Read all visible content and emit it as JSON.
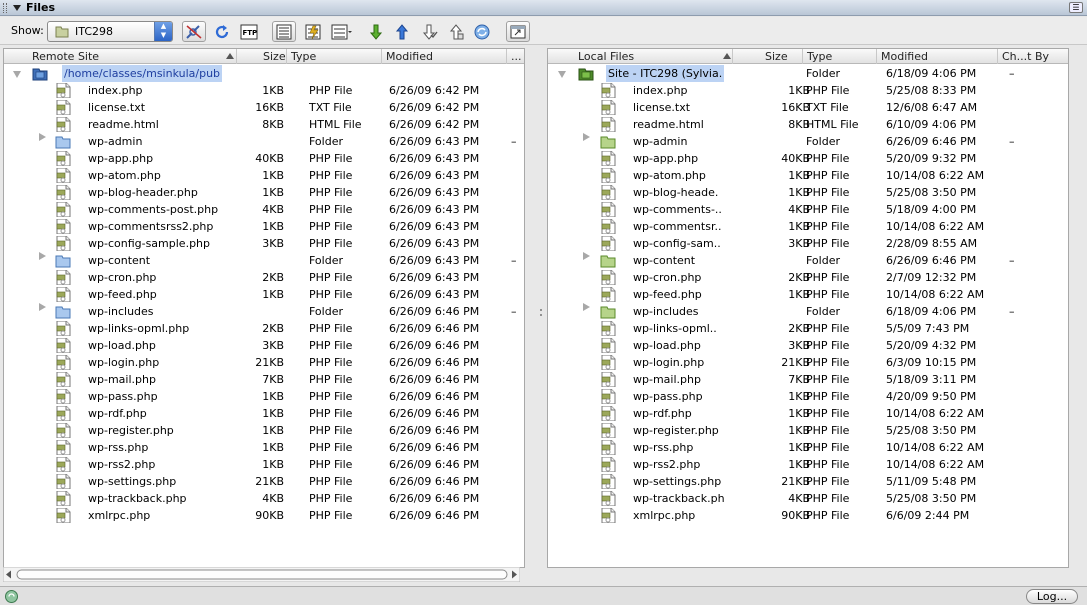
{
  "panel": {
    "title": "Files"
  },
  "toolbar": {
    "show_label": "Show:",
    "site_value": "ITC298"
  },
  "remote": {
    "headers": {
      "name": "Remote Site",
      "size": "Size",
      "type": "Type",
      "modified": "Modified",
      "more": "..."
    },
    "root": "/home/classes/msinkula/pub",
    "rows": [
      {
        "name": "index.php",
        "size": "1KB",
        "type": "PHP File",
        "modified": "6/26/09 6:42 PM",
        "folder": false
      },
      {
        "name": "license.txt",
        "size": "16KB",
        "type": "TXT File",
        "modified": "6/26/09 6:42 PM",
        "folder": false
      },
      {
        "name": "readme.html",
        "size": "8KB",
        "type": "HTML File",
        "modified": "6/26/09 6:42 PM",
        "folder": false
      },
      {
        "name": "wp-admin",
        "size": "",
        "type": "Folder",
        "modified": "6/26/09 6:43 PM",
        "folder": true,
        "extra": "–"
      },
      {
        "name": "wp-app.php",
        "size": "40KB",
        "type": "PHP File",
        "modified": "6/26/09 6:43 PM",
        "folder": false
      },
      {
        "name": "wp-atom.php",
        "size": "1KB",
        "type": "PHP File",
        "modified": "6/26/09 6:43 PM",
        "folder": false
      },
      {
        "name": "wp-blog-header.php",
        "size": "1KB",
        "type": "PHP File",
        "modified": "6/26/09 6:43 PM",
        "folder": false
      },
      {
        "name": "wp-comments-post.php",
        "size": "4KB",
        "type": "PHP File",
        "modified": "6/26/09 6:43 PM",
        "folder": false
      },
      {
        "name": "wp-commentsrss2.php",
        "size": "1KB",
        "type": "PHP File",
        "modified": "6/26/09 6:43 PM",
        "folder": false
      },
      {
        "name": "wp-config-sample.php",
        "size": "3KB",
        "type": "PHP File",
        "modified": "6/26/09 6:43 PM",
        "folder": false
      },
      {
        "name": "wp-content",
        "size": "",
        "type": "Folder",
        "modified": "6/26/09 6:43 PM",
        "folder": true,
        "extra": "–"
      },
      {
        "name": "wp-cron.php",
        "size": "2KB",
        "type": "PHP File",
        "modified": "6/26/09 6:43 PM",
        "folder": false
      },
      {
        "name": "wp-feed.php",
        "size": "1KB",
        "type": "PHP File",
        "modified": "6/26/09 6:43 PM",
        "folder": false
      },
      {
        "name": "wp-includes",
        "size": "",
        "type": "Folder",
        "modified": "6/26/09 6:46 PM",
        "folder": true,
        "extra": "–"
      },
      {
        "name": "wp-links-opml.php",
        "size": "2KB",
        "type": "PHP File",
        "modified": "6/26/09 6:46 PM",
        "folder": false
      },
      {
        "name": "wp-load.php",
        "size": "3KB",
        "type": "PHP File",
        "modified": "6/26/09 6:46 PM",
        "folder": false
      },
      {
        "name": "wp-login.php",
        "size": "21KB",
        "type": "PHP File",
        "modified": "6/26/09 6:46 PM",
        "folder": false
      },
      {
        "name": "wp-mail.php",
        "size": "7KB",
        "type": "PHP File",
        "modified": "6/26/09 6:46 PM",
        "folder": false
      },
      {
        "name": "wp-pass.php",
        "size": "1KB",
        "type": "PHP File",
        "modified": "6/26/09 6:46 PM",
        "folder": false
      },
      {
        "name": "wp-rdf.php",
        "size": "1KB",
        "type": "PHP File",
        "modified": "6/26/09 6:46 PM",
        "folder": false
      },
      {
        "name": "wp-register.php",
        "size": "1KB",
        "type": "PHP File",
        "modified": "6/26/09 6:46 PM",
        "folder": false
      },
      {
        "name": "wp-rss.php",
        "size": "1KB",
        "type": "PHP File",
        "modified": "6/26/09 6:46 PM",
        "folder": false
      },
      {
        "name": "wp-rss2.php",
        "size": "1KB",
        "type": "PHP File",
        "modified": "6/26/09 6:46 PM",
        "folder": false
      },
      {
        "name": "wp-settings.php",
        "size": "21KB",
        "type": "PHP File",
        "modified": "6/26/09 6:46 PM",
        "folder": false
      },
      {
        "name": "wp-trackback.php",
        "size": "4KB",
        "type": "PHP File",
        "modified": "6/26/09 6:46 PM",
        "folder": false
      },
      {
        "name": "xmlrpc.php",
        "size": "90KB",
        "type": "PHP File",
        "modified": "6/26/09 6:46 PM",
        "folder": false
      }
    ]
  },
  "local": {
    "headers": {
      "name": "Local Files",
      "size": "Size",
      "type": "Type",
      "modified": "Modified",
      "checked": "Ch...t By"
    },
    "root": {
      "name": "Site - ITC298 (Sylvia.",
      "type": "Folder",
      "modified": "6/18/09 4:06 PM",
      "extra": "–"
    },
    "rows": [
      {
        "name": "index.php",
        "size": "1KB",
        "type": "PHP File",
        "modified": "5/25/08 8:33 PM",
        "folder": false
      },
      {
        "name": "license.txt",
        "size": "16KB",
        "type": "TXT File",
        "modified": "12/6/08 6:47 AM",
        "folder": false
      },
      {
        "name": "readme.html",
        "size": "8KB",
        "type": "HTML File",
        "modified": "6/10/09 4:06 PM",
        "folder": false
      },
      {
        "name": "wp-admin",
        "size": "",
        "type": "Folder",
        "modified": "6/26/09 6:46 PM",
        "folder": true,
        "extra": "–"
      },
      {
        "name": "wp-app.php",
        "size": "40KB",
        "type": "PHP File",
        "modified": "5/20/09 9:32 PM",
        "folder": false
      },
      {
        "name": "wp-atom.php",
        "size": "1KB",
        "type": "PHP File",
        "modified": "10/14/08 6:22 AM",
        "folder": false
      },
      {
        "name": "wp-blog-heade.",
        "size": "1KB",
        "type": "PHP File",
        "modified": "5/25/08 3:50 PM",
        "folder": false
      },
      {
        "name": "wp-comments-..",
        "size": "4KB",
        "type": "PHP File",
        "modified": "5/18/09 4:00 PM",
        "folder": false
      },
      {
        "name": "wp-commentsr..",
        "size": "1KB",
        "type": "PHP File",
        "modified": "10/14/08 6:22 AM",
        "folder": false
      },
      {
        "name": "wp-config-sam..",
        "size": "3KB",
        "type": "PHP File",
        "modified": "2/28/09 8:55 AM",
        "folder": false
      },
      {
        "name": "wp-content",
        "size": "",
        "type": "Folder",
        "modified": "6/26/09 6:46 PM",
        "folder": true,
        "extra": "–"
      },
      {
        "name": "wp-cron.php",
        "size": "2KB",
        "type": "PHP File",
        "modified": "2/7/09 12:32 PM",
        "folder": false
      },
      {
        "name": "wp-feed.php",
        "size": "1KB",
        "type": "PHP File",
        "modified": "10/14/08 6:22 AM",
        "folder": false
      },
      {
        "name": "wp-includes",
        "size": "",
        "type": "Folder",
        "modified": "6/18/09 4:06 PM",
        "folder": true,
        "extra": "–"
      },
      {
        "name": "wp-links-opml..",
        "size": "2KB",
        "type": "PHP File",
        "modified": "5/5/09 7:43 PM",
        "folder": false
      },
      {
        "name": "wp-load.php",
        "size": "3KB",
        "type": "PHP File",
        "modified": "5/20/09 4:32 PM",
        "folder": false
      },
      {
        "name": "wp-login.php",
        "size": "21KB",
        "type": "PHP File",
        "modified": "6/3/09 10:15 PM",
        "folder": false
      },
      {
        "name": "wp-mail.php",
        "size": "7KB",
        "type": "PHP File",
        "modified": "5/18/09 3:11 PM",
        "folder": false
      },
      {
        "name": "wp-pass.php",
        "size": "1KB",
        "type": "PHP File",
        "modified": "4/20/09 9:50 PM",
        "folder": false
      },
      {
        "name": "wp-rdf.php",
        "size": "1KB",
        "type": "PHP File",
        "modified": "10/14/08 6:22 AM",
        "folder": false
      },
      {
        "name": "wp-register.php",
        "size": "1KB",
        "type": "PHP File",
        "modified": "5/25/08 3:50 PM",
        "folder": false
      },
      {
        "name": "wp-rss.php",
        "size": "1KB",
        "type": "PHP File",
        "modified": "10/14/08 6:22 AM",
        "folder": false
      },
      {
        "name": "wp-rss2.php",
        "size": "1KB",
        "type": "PHP File",
        "modified": "10/14/08 6:22 AM",
        "folder": false
      },
      {
        "name": "wp-settings.php",
        "size": "21KB",
        "type": "PHP File",
        "modified": "5/11/09 5:48 PM",
        "folder": false
      },
      {
        "name": "wp-trackback.ph",
        "size": "4KB",
        "type": "PHP File",
        "modified": "5/25/08 3:50 PM",
        "folder": false
      },
      {
        "name": "xmlrpc.php",
        "size": "90KB",
        "type": "PHP File",
        "modified": "6/6/09 2:44 PM",
        "folder": false
      }
    ]
  },
  "status": {
    "log_label": "Log..."
  },
  "icons": {
    "file": "php-file-icon",
    "remote-folder": "blue-folder-icon",
    "local-folder": "green-folder-icon",
    "connect": "connect-icon",
    "refresh": "refresh-icon",
    "ftp-log": "ftp-log-icon",
    "view-remote": "remote-view-icon",
    "view-testing": "testing-server-icon",
    "view-repo": "repository-icon",
    "get": "get-arrow-icon",
    "put": "put-arrow-icon",
    "checkout": "check-out-icon",
    "checkin": "check-in-icon",
    "sync": "synchronize-icon",
    "expand": "expand-icon"
  },
  "colors": {
    "selection": "#bcd3f4",
    "site_root_text": "#1f3fa0",
    "title_bar": "#c9d3e0"
  }
}
